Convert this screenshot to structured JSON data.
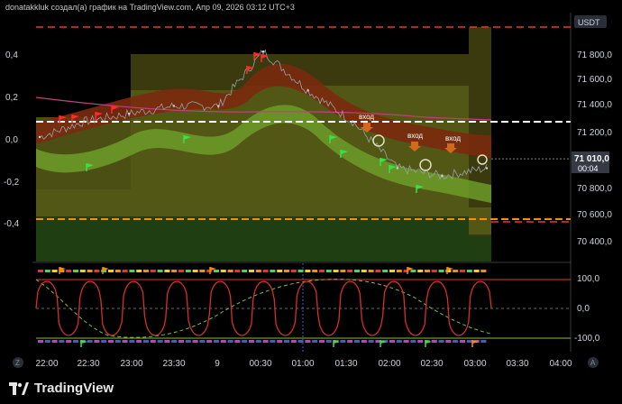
{
  "header": {
    "attribution": "donatakkluk создал(а) график на TradingView.com, Апр 09, 2026 03:12 UTC+3"
  },
  "branding": {
    "name": "TradingView"
  },
  "currency": "USDT",
  "price_axis": {
    "ticks": [
      "71 800,0",
      "71 600,0",
      "71 400,0",
      "71 200,0",
      "70 800,0",
      "70 600,0",
      "70 400,0"
    ],
    "last_price": "71 010,0",
    "countdown": "00:04"
  },
  "left_axis": {
    "ticks": [
      "0,4",
      "0,2",
      "0,0",
      "-0,2",
      "-0,4"
    ]
  },
  "osc_axis": {
    "ticks": [
      "100,0",
      "0,0",
      "-100,0"
    ]
  },
  "time_axis": {
    "ticks": [
      "22:00",
      "22:30",
      "23:00",
      "23:30",
      "9",
      "00:30",
      "01:00",
      "01:30",
      "02:00",
      "02:30",
      "03:00",
      "03:30",
      "04:00"
    ]
  },
  "annotations": {
    "entry_labels": [
      "вход",
      "вход",
      "вход"
    ]
  },
  "axis_buttons": {
    "left": "Z",
    "right": "A"
  },
  "colors": {
    "background": "#000000",
    "band_dark": "#3a3a10",
    "band_light": "#5a6a1a",
    "channel_upper": "#8b2a10",
    "channel_lower": "#6a9a2a",
    "red_dash": "#e53935",
    "white_dash": "#ffffff",
    "orange_dash": "#ff8c00",
    "osc_line": "#d32f2f",
    "osc_dash": "#7fbf3f"
  },
  "chart_data": {
    "type": "line",
    "x": [
      "22:00",
      "22:30",
      "23:00",
      "23:30",
      "00:00",
      "00:30",
      "01:00",
      "01:30",
      "02:00",
      "02:30",
      "03:00"
    ],
    "series": [
      {
        "values": [
          71150,
          71250,
          71300,
          71350,
          71350,
          71700,
          71450,
          71250,
          70950,
          70900,
          70950
        ]
      }
    ],
    "right_ylim": [
      70350,
      71950
    ],
    "osc_ylim": [
      -100,
      100
    ]
  }
}
